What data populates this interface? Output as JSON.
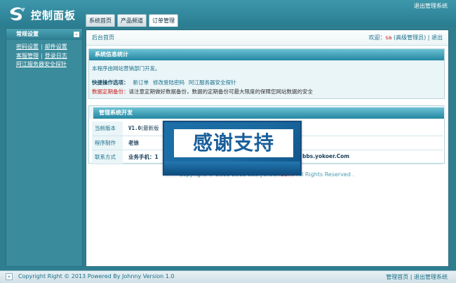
{
  "header": {
    "title": "控制面板",
    "logout": "退出管理系统",
    "tabs": [
      {
        "label": "系统首页"
      },
      {
        "label": "产品频道"
      },
      {
        "label": "订单管理"
      }
    ]
  },
  "sidebar": {
    "title": "常规设置",
    "toggle": "-",
    "links": [
      [
        "密码设置",
        "邮件设置"
      ],
      [
        "客服管理",
        "登录日志"
      ],
      [
        "阿江服务器安全探针"
      ]
    ],
    "sep": "|"
  },
  "breadcrumb": {
    "label": "后台首页",
    "welcome_prefix": "欢迎：",
    "user": "sa",
    "role": "(高级管理员)",
    "sep": "|",
    "logout": "退出"
  },
  "panel_stats": {
    "title": "系统信息统计",
    "intro": "本程序由网站营销部门开发。",
    "quick_label": "快捷操作选项：",
    "quick_links": [
      "新订单",
      "修改登陆密码",
      "阿江服务器安全探针"
    ],
    "backup_label": "数据定期备份：",
    "backup_text": "请注意定期做好数据备份，数据的定期备份可最大限度的保障您网站数据的安全"
  },
  "panel_dev": {
    "title": "管理系统开发",
    "rows": [
      {
        "key": "当前版本",
        "value": "V1.0",
        "extra": "(最新版"
      },
      {
        "key": "程序制作",
        "value": "老徐",
        "extra": ""
      },
      {
        "key": "联系方式",
        "value": "业务手机：1",
        "extra": "bbs.yokoer.Com"
      }
    ]
  },
  "copyright": {
    "prefix": "Copyright © 2011-2012",
    "site_a": "bbs.yokoer.",
    "site_b": "Com",
    "suffix": ". All Rights Reserved ."
  },
  "overlay": {
    "text": "感谢支持"
  },
  "footer": {
    "toggle": "«",
    "copyright": "Copyright Right © 2013 Powered By Johnny Version 1.0",
    "home": "管理首页",
    "sep": "|",
    "logout": "退出管理系统"
  }
}
